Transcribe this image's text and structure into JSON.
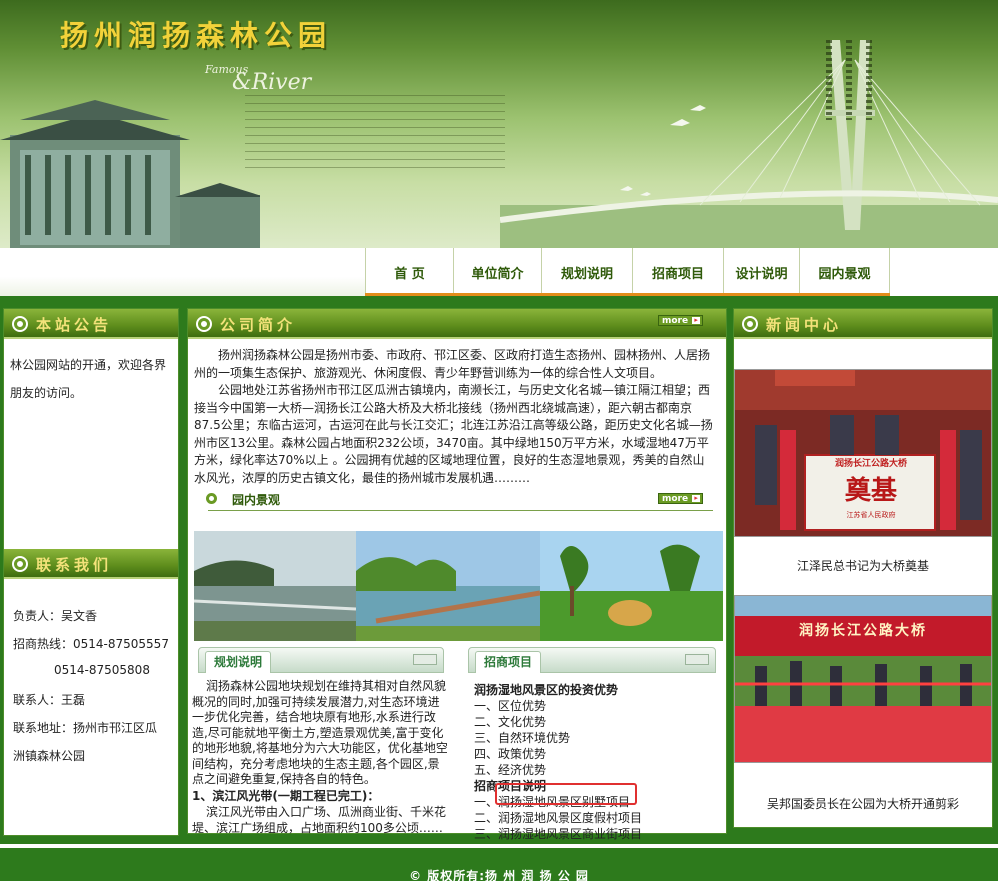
{
  "header": {
    "site_title": "扬州润扬森林公园",
    "banner_tagline_1": "Famous",
    "banner_tagline_2": "&River"
  },
  "nav": {
    "items": [
      {
        "label": "首 页"
      },
      {
        "label": "单位简介"
      },
      {
        "label": "规划说明"
      },
      {
        "label": "招商项目"
      },
      {
        "label": "设计说明"
      },
      {
        "label": "园内景观"
      }
    ],
    "accent_color": "#e38d1a"
  },
  "left": {
    "notice_title": "本站公告",
    "notice_text": "林公园网站的开通，欢迎各界朋友的访问。",
    "contact_title": "联系我们",
    "contact": {
      "person": "负责人：吴文香",
      "hotline": "招商热线：0514-87505557",
      "hotline2": "0514-87505808",
      "contact_person": "联系人：王磊",
      "address_1": "联系地址：扬州市邗江区瓜",
      "address_2": "洲镇森林公园"
    }
  },
  "center": {
    "intro_title": "公司简介",
    "more_label": "more",
    "intro_p1": "扬州润扬森林公园是扬州市委、市政府、邗江区委、区政府打造生态扬州、园林扬州、人居扬州的一项集生态保护、旅游观光、休闲度假、青少年野营训练为一体的综合性人文项目。",
    "intro_p2": "公园地处江苏省扬州市邗江区瓜洲古镇境内，南濒长江，与历史文化名城—镇江隔江相望；西接当今中国第一大桥—润扬长江公路大桥及大桥北接线（扬州西北绕城高速），距六朝古都南京87.5公里；东临古运河，古运河在此与长江交汇；北连江苏沿江高等级公路，距历史文化名城—扬州市区13公里。森林公园占地面积232公顷，3470亩。其中绿地150万平方米，水域湿地47万平方米，绿化率达70%以上 。公园拥有优越的区域地理位置，良好的生态湿地景观，秀美的自然山水风光，浓厚的历史古镇文化，最佳的扬州城市发展机遇………",
    "scenery_title": "园内景观",
    "plan_tab": "规划说明",
    "plan_p1": "润扬森林公园地块规划在维持其相对自然风貌概况的同时,加强可持续发展潜力,对生态环境进一步优化完善，结合地块原有地形,水系进行改造,尽可能就地平衡土方,塑造景观优美,富于变化的地形地貌,将基地分为六大功能区，优化基地空间结构，充分考虑地块的生态主题,各个园区,景点之间避免重复,保持各自的特色。",
    "plan_h": "1、滨江风光带(一期工程已完工)：",
    "plan_p2": "滨江风光带由入口广场、瓜洲商业街、千米花堤、滨江广场组成，占地面积约100多公顷……",
    "invest_tab": "招商项目",
    "invest_title": "润扬湿地风景区的投资优势",
    "invest_items": [
      "一、区位优势",
      "二、文化优势",
      "三、自然环境优势",
      "四、政策优势",
      "五、经济优势"
    ],
    "projects_title": "招商项目说明",
    "project_items": [
      "一、润扬湿地风景区别墅项目",
      "二、润扬湿地风景区度假村项目",
      "三、润扬湿地风景区商业街项目"
    ]
  },
  "right": {
    "news_title": "新闻中心",
    "news": [
      {
        "caption": "江泽民总书记为大桥奠基",
        "sign_text": "润扬长江公路大桥",
        "sign_big": "奠基",
        "sign_small": "江苏省人民政府"
      },
      {
        "caption": "吴邦国委员长在公园为大桥开通剪彩",
        "banner_text": "润扬长江公路大桥"
      }
    ]
  },
  "footer": {
    "copyright": "© 版权所有:扬 州 润 扬 公 园"
  }
}
